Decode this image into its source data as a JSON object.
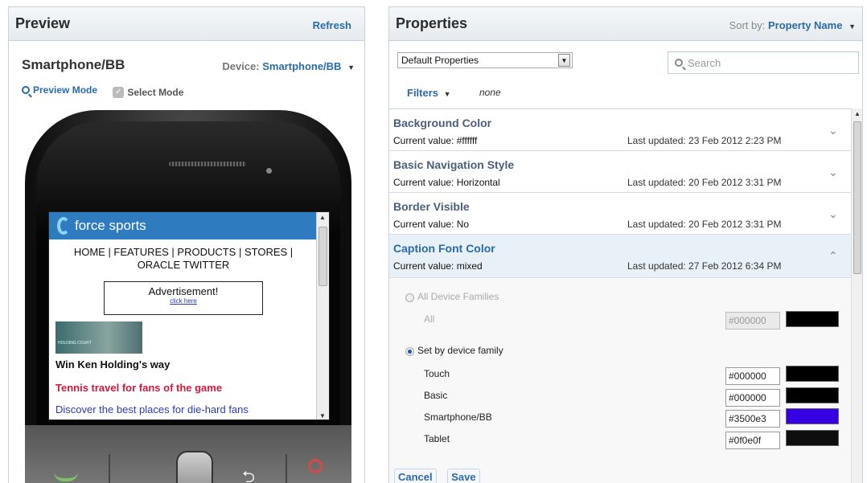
{
  "preview": {
    "title": "Preview",
    "refresh": "Refresh",
    "device_name": "Smartphone/BB",
    "device_label": "Device:",
    "device_value": "Smartphone/BB",
    "preview_mode": "Preview Mode",
    "select_mode": "Select Mode",
    "screen": {
      "brand": "force sports",
      "nav": "HOME | FEATURES | PRODUCTS | STORES | ORACLE TWITTER",
      "ad_title": "Advertisement!",
      "ad_link": "click here",
      "thumb_caption": "HOLDING COURT",
      "headline": "Win Ken Holding's way",
      "subhead": "Tennis travel for fans of the game",
      "link": "Discover the best places for die-hard fans"
    }
  },
  "properties": {
    "title": "Properties",
    "sort_label": "Sort by:",
    "sort_value": "Property Name",
    "select_value": "Default Properties",
    "search_placeholder": "Search",
    "filters_label": "Filters",
    "filters_value": "none",
    "items": [
      {
        "name": "Background Color",
        "current": "Current value: #ffffff",
        "updated": "Last updated: 23 Feb 2012 2:23 PM"
      },
      {
        "name": "Basic Navigation Style",
        "current": "Current value: Horizontal",
        "updated": "Last updated: 20 Feb 2012 3:31 PM"
      },
      {
        "name": "Border Visible",
        "current": "Current value: No",
        "updated": "Last updated: 20 Feb 2012 3:31 PM"
      },
      {
        "name": "Caption Font Color",
        "current": "Current value: mixed",
        "updated": "Last updated: 27 Feb 2012 6:34 PM"
      }
    ],
    "expanded": {
      "all_families_label": "All Device Families",
      "all_label": "All",
      "all_value": "#000000",
      "set_by_family_label": "Set by device family",
      "families": [
        {
          "label": "Touch",
          "value": "#000000",
          "color": "#000000"
        },
        {
          "label": "Basic",
          "value": "#000000",
          "color": "#000000"
        },
        {
          "label": "Smartphone/BB",
          "value": "#3500e3",
          "color": "#3500e3"
        },
        {
          "label": "Tablet",
          "value": "#0f0e0f",
          "color": "#0f0e0f"
        }
      ]
    },
    "cancel": "Cancel",
    "save": "Save"
  },
  "colors": {
    "accent": "#2b6aa8",
    "banner": "#2f7bbf",
    "headline_red": "#d11a3a"
  }
}
